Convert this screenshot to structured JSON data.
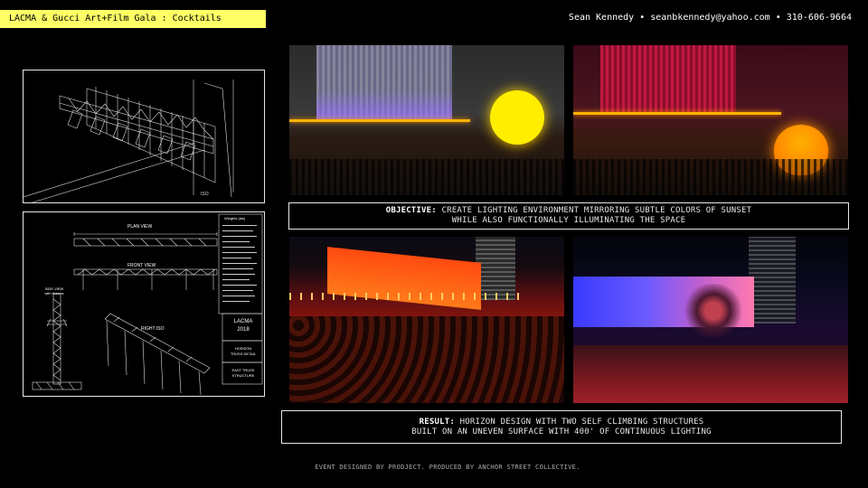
{
  "header": {
    "project_title": "LACMA & Gucci Art+Film Gala : Cocktails",
    "contact_line": "Sean Kennedy • seanbkennedy@yahoo.com • 310-606-9664"
  },
  "drawing": {
    "plan_view_label": "PLAN VIEW",
    "front_view_label": "FRONT VIEW",
    "side_view_label": "SIDE VIEW\nwith fixtures",
    "right_iso_label": "RIGHT ISO",
    "isometric_label": "ISO",
    "weights_label": "Weights (lbs)",
    "title_block": {
      "venue": "LACMA",
      "year": "2018",
      "sheet_title": "HORIZON\nTRUSS DETAIL",
      "structure": "EAST TRUSS\nSTRUCTURE"
    }
  },
  "objective": {
    "label": "OBJECTIVE:",
    "line1": "CREATE LIGHTING ENVIRONMENT MIRRORING SUBTLE COLORS OF SUNSET",
    "line2": "WHILE ALSO FUNCTIONALLY ILLUMINATING THE SPACE"
  },
  "result": {
    "label": "RESULT:",
    "line1": "HORIZON DESIGN WITH TWO SELF CLIMBING STRUCTURES",
    "line2": "BUILT ON AN UNEVEN SURFACE WITH 400' OF CONTINUOUS LIGHTING"
  },
  "footer": {
    "credit": "EVENT DESIGNED BY PRODJECT. PRODUCED BY ANCHOR STREET COLLECTIVE."
  },
  "colors": {
    "title_bar": "#ffff66",
    "sun_yellow": "#ffee00",
    "sun_orange": "#ff9a00",
    "light_line": "#ffb300"
  }
}
